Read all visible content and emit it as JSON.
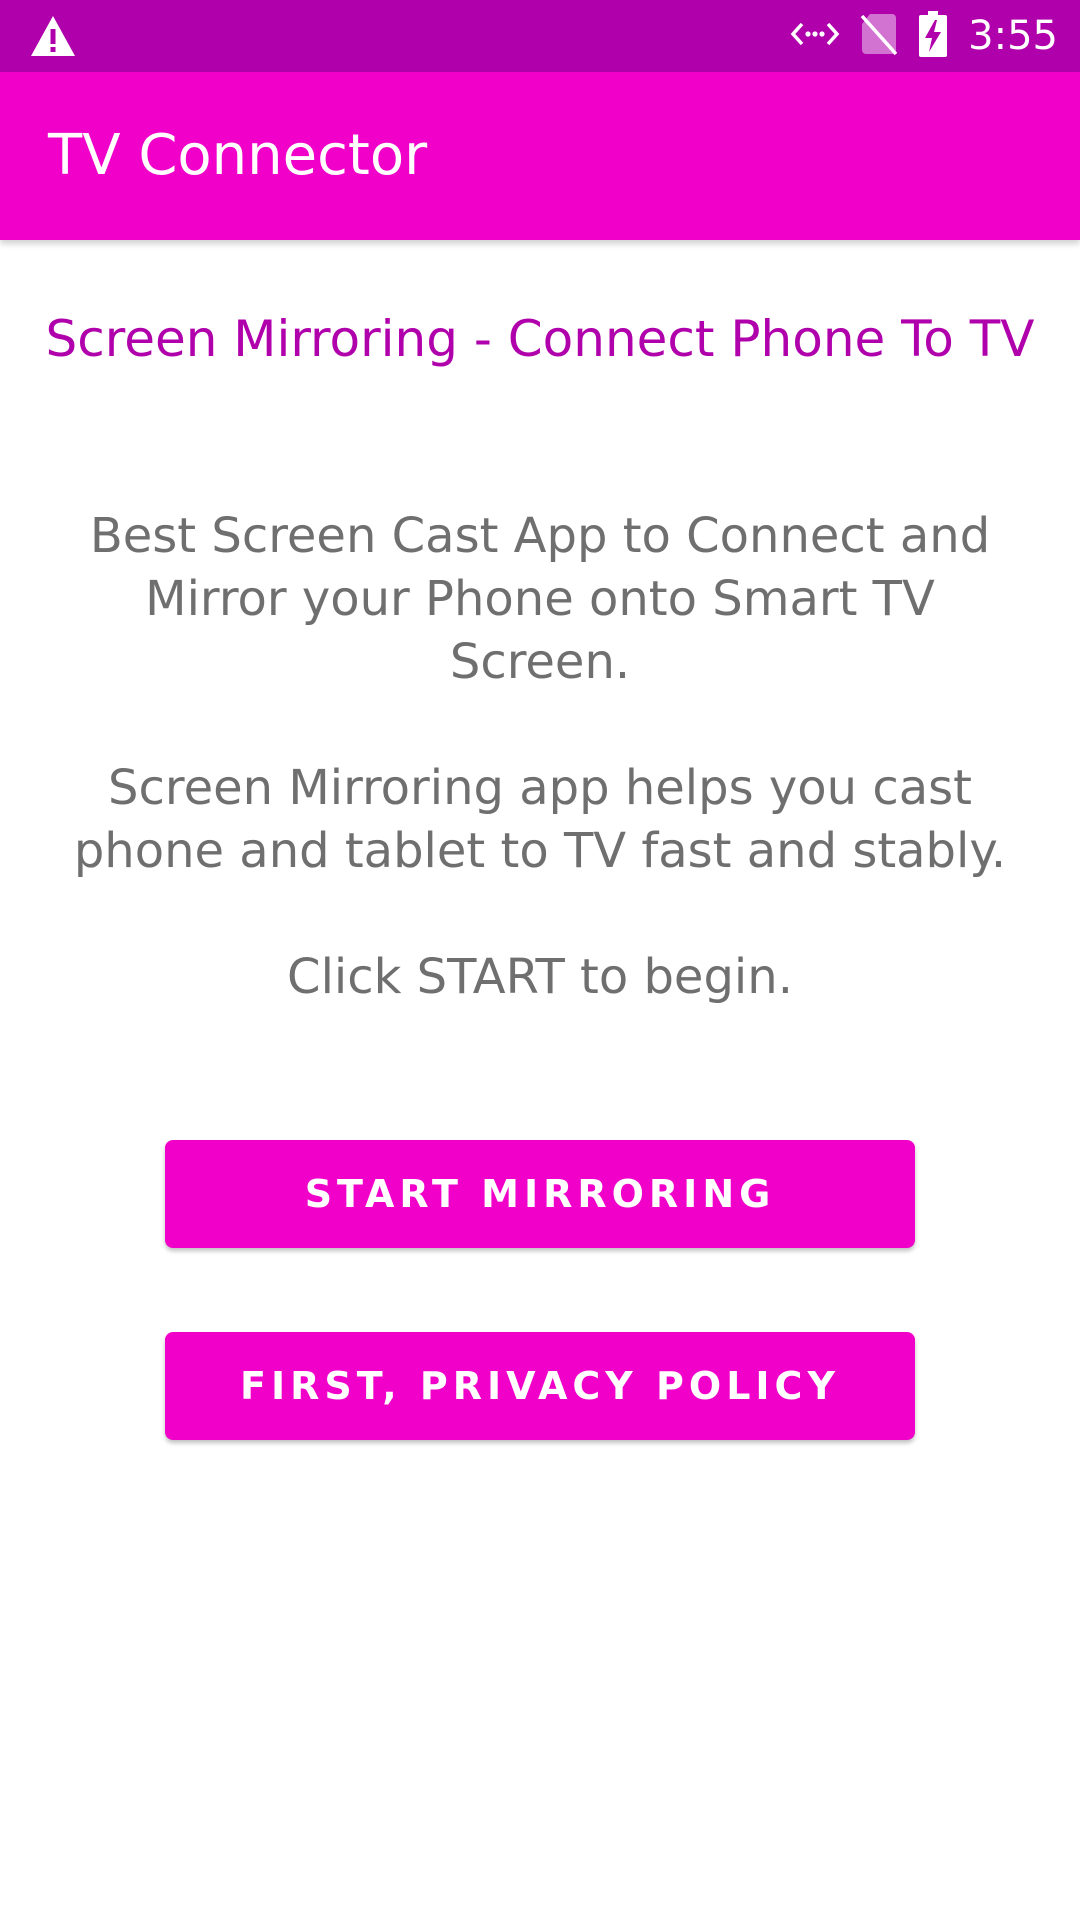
{
  "status_bar": {
    "time": "3:55",
    "icons": [
      "warning-icon",
      "data-transfer-icon",
      "no-sim-icon",
      "battery-charging-icon"
    ],
    "color": "#b000ab"
  },
  "app_bar": {
    "title": "TV Connector",
    "color": "#f000c8"
  },
  "main": {
    "headline": "Screen Mirroring - Connect Phone To TV",
    "paragraphs": [
      "Best Screen Cast App to Connect and Mirror your Phone onto Smart TV Screen.",
      "Screen Mirroring app helps you cast phone and tablet to TV fast and stably.",
      "Click START to begin."
    ],
    "headline_color": "#b000ab",
    "text_color": "#6f6f6f"
  },
  "buttons": {
    "start_label": "START MIRRORING",
    "privacy_label": "FIRST, PRIVACY POLICY",
    "color": "#f000c8"
  }
}
